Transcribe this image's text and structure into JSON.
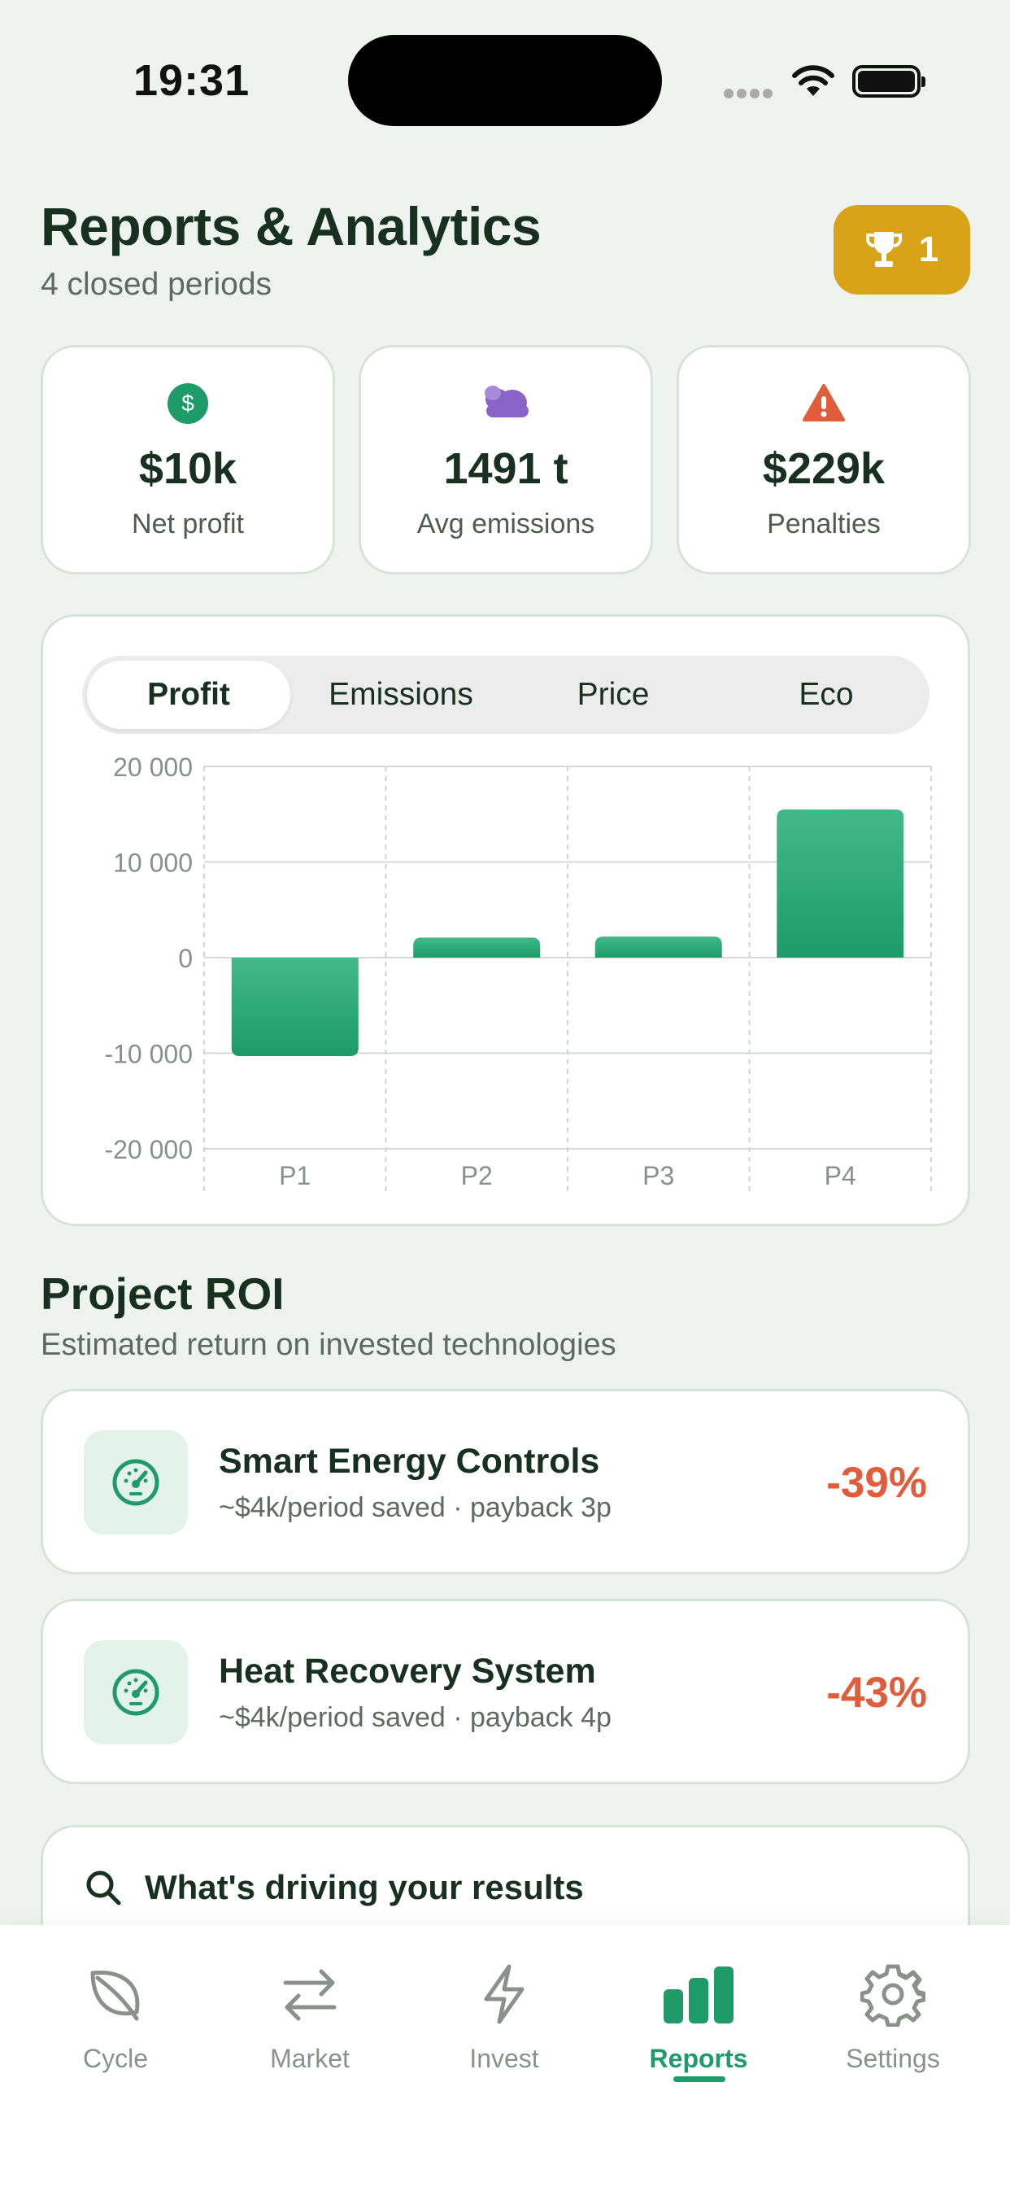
{
  "status_bar": {
    "time": "19:31"
  },
  "header": {
    "title": "Reports & Analytics",
    "subtitle": "4 closed periods",
    "trophy_count": "1"
  },
  "stats": [
    {
      "value": "$10k",
      "label": "Net profit",
      "icon": "dollar-icon",
      "color": "#1f9b6a"
    },
    {
      "value": "1491 t",
      "label": "Avg emissions",
      "icon": "cloud-icon",
      "color": "#8a63c9"
    },
    {
      "value": "$229k",
      "label": "Penalties",
      "icon": "warning-icon",
      "color": "#e05c3a"
    }
  ],
  "chart_tabs": [
    {
      "label": "Profit",
      "active": true
    },
    {
      "label": "Emissions",
      "active": false
    },
    {
      "label": "Price",
      "active": false
    },
    {
      "label": "Eco",
      "active": false
    }
  ],
  "chart_data": {
    "type": "bar",
    "categories": [
      "P1",
      "P2",
      "P3",
      "P4"
    ],
    "values": [
      -10300,
      2100,
      2200,
      15500
    ],
    "yticks": [
      20000,
      10000,
      0,
      -10000,
      -20000
    ],
    "ytick_labels": [
      "20 000",
      "10 000",
      "0",
      "-10 000",
      "-20 000"
    ],
    "ylim": [
      -20000,
      20000
    ],
    "grid": true,
    "bar_color": "#1f9b6a"
  },
  "roi": {
    "title": "Project ROI",
    "subtitle": "Estimated return on invested technologies",
    "projects": [
      {
        "name": "Smart Energy Controls",
        "meta": "~$4k/period saved · payback 3p",
        "roi": "-39%"
      },
      {
        "name": "Heat Recovery System",
        "meta": "~$4k/period saved · payback 4p",
        "roi": "-43%"
      }
    ]
  },
  "drivers": {
    "title": "What's driving your results"
  },
  "tab_bar": [
    {
      "label": "Cycle",
      "icon": "leaf-icon",
      "active": false
    },
    {
      "label": "Market",
      "icon": "swap-arrows-icon",
      "active": false
    },
    {
      "label": "Invest",
      "icon": "lightning-icon",
      "active": false
    },
    {
      "label": "Reports",
      "icon": "bar-chart-icon",
      "active": true
    },
    {
      "label": "Settings",
      "icon": "gear-icon",
      "active": false
    }
  ],
  "colors": {
    "accent": "#1f9b6a",
    "negative": "#e05c3a",
    "trophy": "#d8a219"
  }
}
